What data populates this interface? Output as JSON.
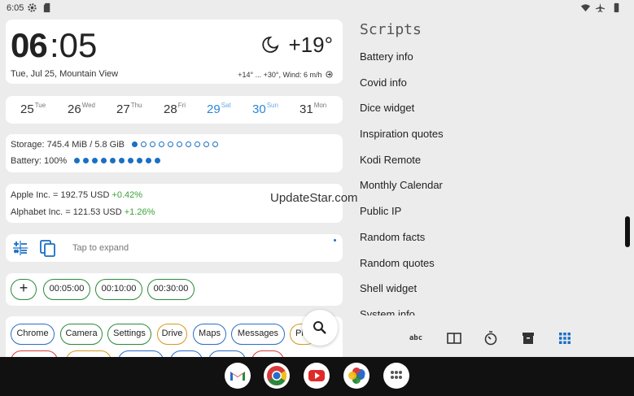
{
  "status_bar": {
    "time": "6:05"
  },
  "clock": {
    "hours": "06",
    "minutes": ":05",
    "date_location": "Tue, Jul 25, Mountain View",
    "temperature": "+19°",
    "weather_detail": "+14° ... +30°, Wind: 6 m/h"
  },
  "calendar": {
    "days": [
      {
        "num": "25",
        "name": "Tue"
      },
      {
        "num": "26",
        "name": "Wed"
      },
      {
        "num": "27",
        "name": "Thu"
      },
      {
        "num": "28",
        "name": "Fri"
      },
      {
        "num": "29",
        "name": "Sat"
      },
      {
        "num": "30",
        "name": "Sun"
      },
      {
        "num": "31",
        "name": "Mon"
      }
    ]
  },
  "info": {
    "storage": "Storage: 745.4 MiB / 5.8 GiB",
    "storage_level": 0.1,
    "battery": "Battery: 100%",
    "battery_level": 1.0
  },
  "stocks": [
    {
      "label": "Apple Inc. = 192.75 USD",
      "change": "+0.42%"
    },
    {
      "label": "Alphabet Inc. = 121.53 USD",
      "change": "+1.26%"
    }
  ],
  "notes": {
    "placeholder": "Tap to expand"
  },
  "timers": [
    "00:05:00",
    "00:10:00",
    "00:30:00"
  ],
  "apps": [
    "Chrome",
    "Camera",
    "Settings",
    "Drive",
    "Maps",
    "Messages",
    "Pl"
  ],
  "scripts": {
    "title": "Scripts",
    "items": [
      "Battery info",
      "Covid info",
      "Dice widget",
      "Inspiration quotes",
      "Kodi Remote",
      "Monthly Calendar",
      "Public IP",
      "Random facts",
      "Random quotes",
      "Shell widget",
      "System info"
    ]
  },
  "tabs": {
    "abc_label": "abc"
  },
  "watermark": "UpdateStar.com",
  "colors": {
    "accent_blue": "#2a86d8",
    "positive": "#3aa33a",
    "timer_border": "#2a8a3a"
  }
}
